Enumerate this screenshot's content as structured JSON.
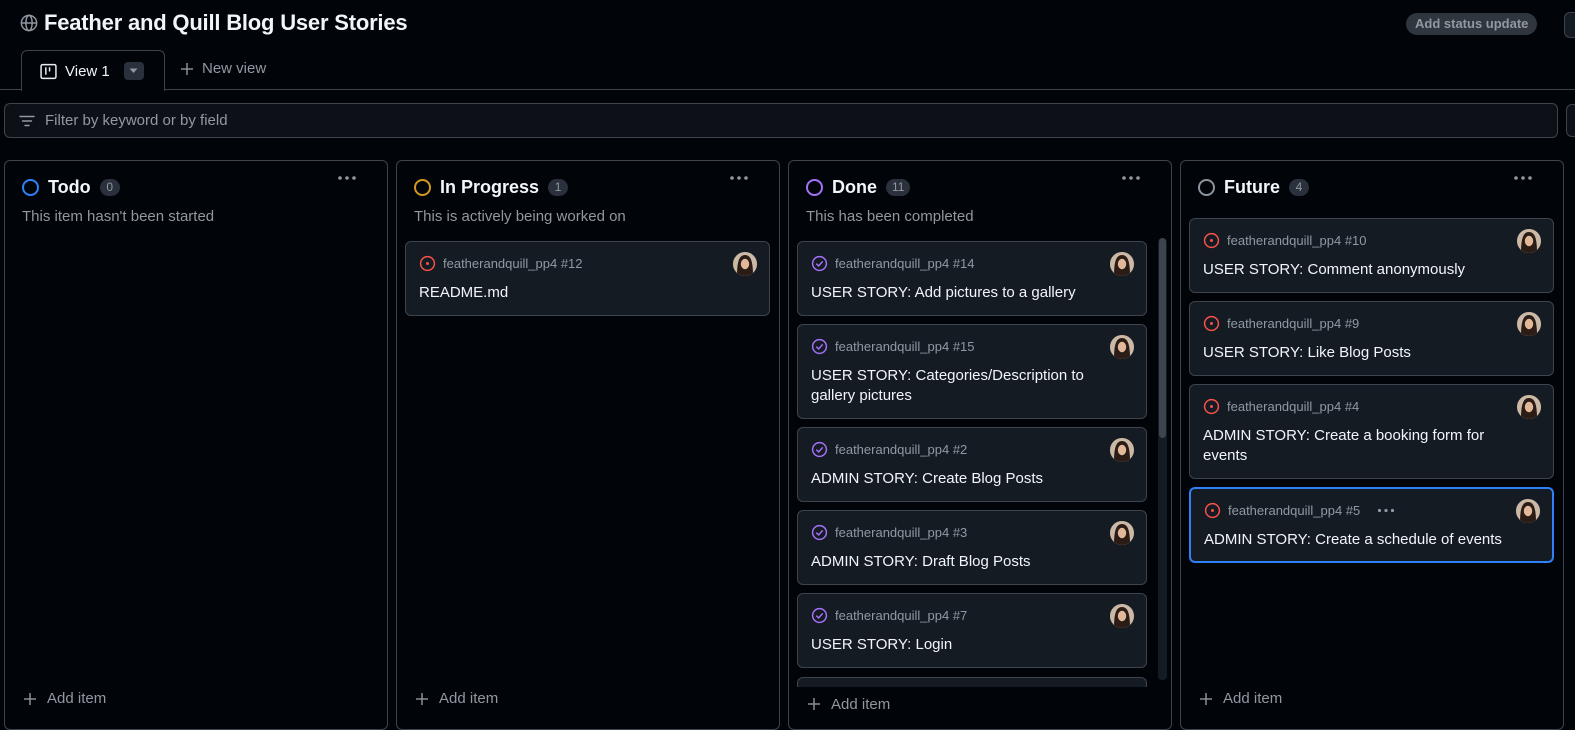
{
  "project": {
    "title": "Feather and Quill Blog User Stories",
    "status_button": "Add status update"
  },
  "tabs": {
    "active_label": "View 1",
    "new_view_label": "New view"
  },
  "filter": {
    "placeholder": "Filter by keyword or by field"
  },
  "colors": {
    "todo": "#2f81f7",
    "in_progress": "#d29922",
    "done": "#a371f7",
    "future": "#8b949e",
    "open_issue": "#f85149",
    "closed_issue": "#a371f7",
    "selected_border": "#2f81f7"
  },
  "columns": [
    {
      "name": "Todo",
      "count": "0",
      "description": "This item hasn't been started",
      "add_label": "Add item",
      "cards": []
    },
    {
      "name": "In Progress",
      "count": "1",
      "description": "This is actively being worked on",
      "add_label": "Add item",
      "cards": [
        {
          "ref": "featherandquill_pp4 #12",
          "title": "README.md",
          "state": "open-issue-icon"
        }
      ]
    },
    {
      "name": "Done",
      "count": "11",
      "description": "This has been completed",
      "add_label": "Add item",
      "cards": [
        {
          "ref": "featherandquill_pp4 #14",
          "title": "USER STORY: Add pictures to a gallery",
          "state": "closed-issue-icon"
        },
        {
          "ref": "featherandquill_pp4 #15",
          "title": "USER STORY: Categories/Description to gallery pictures",
          "state": "closed-issue-icon"
        },
        {
          "ref": "featherandquill_pp4 #2",
          "title": "ADMIN STORY: Create Blog Posts",
          "state": "closed-issue-icon"
        },
        {
          "ref": "featherandquill_pp4 #3",
          "title": "ADMIN STORY: Draft Blog Posts",
          "state": "closed-issue-icon"
        },
        {
          "ref": "featherandquill_pp4 #7",
          "title": "USER STORY: Login",
          "state": "closed-issue-icon"
        }
      ]
    },
    {
      "name": "Future",
      "count": "4",
      "description": "",
      "add_label": "Add item",
      "cards": [
        {
          "ref": "featherandquill_pp4 #10",
          "title": "USER STORY: Comment anonymously",
          "state": "open-issue-icon"
        },
        {
          "ref": "featherandquill_pp4 #9",
          "title": "USER STORY: Like Blog Posts",
          "state": "open-issue-icon"
        },
        {
          "ref": "featherandquill_pp4 #4",
          "title": "ADMIN STORY: Create a booking form for events",
          "state": "open-issue-icon"
        },
        {
          "ref": "featherandquill_pp4 #5",
          "title": "ADMIN STORY: Create a schedule of events",
          "state": "open-issue-icon"
        }
      ]
    }
  ]
}
